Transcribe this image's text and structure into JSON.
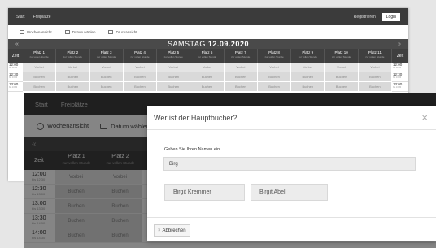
{
  "back": {
    "nav": [
      "Start",
      "Freiplätze"
    ],
    "register": "Registrieren",
    "login": "Login",
    "tools": [
      "Wochenansicht",
      "Datum wählen",
      "Druckansicht"
    ],
    "prev": "«",
    "next": "»",
    "day": "SAMSTAG",
    "date": "12.09.2020",
    "zeit": "Zeit",
    "subtitle": "zur vollen Stunde",
    "courts": [
      "Platz 1",
      "Platz 2",
      "Platz 3",
      "Platz 4",
      "Platz 5",
      "Platz 6",
      "Platz 7",
      "Platz 8",
      "Platz 9",
      "Platz 10",
      "Platz 11"
    ],
    "rows": [
      {
        "time": "12:00",
        "sub": "bis 12:30",
        "label": "Vorbei"
      },
      {
        "time": "12:30",
        "sub": "bis 13:00",
        "label": "Buchen"
      },
      {
        "time": "13:00",
        "sub": "bis 13:30",
        "label": "Buchen"
      }
    ]
  },
  "front": {
    "nav": [
      "Start",
      "Freiplätze"
    ],
    "tools": [
      "Wochenansicht",
      "Datum wählen"
    ],
    "prev": "«",
    "zeit": "Zeit",
    "courts": [
      {
        "name": "Platz 1",
        "sub": "zur vollen Stunde"
      },
      {
        "name": "Platz 2",
        "sub": "zur vollen Stunde"
      }
    ],
    "rows": [
      {
        "time": "12:00",
        "sub": "bis 12:30",
        "label": "Vorbei"
      },
      {
        "time": "12:30",
        "sub": "bis 13:00",
        "label": "Buchen"
      },
      {
        "time": "13:00",
        "sub": "bis 13:30",
        "label": "Buchen"
      },
      {
        "time": "13:30",
        "sub": "bis 14:00",
        "label": "Buchen"
      },
      {
        "time": "14:00",
        "sub": "bis 14:30",
        "label": "Buchen"
      }
    ]
  },
  "modal": {
    "title": "Wer ist der Hauptbucher?",
    "close": "×",
    "prompt": "Geben Sie Ihren Namen ein...",
    "input_value": "Birg",
    "suggestions": [
      "Birgit Kremmer",
      "Birgit Abel"
    ],
    "cancel_icon": "×",
    "cancel": "Abbrechen"
  }
}
